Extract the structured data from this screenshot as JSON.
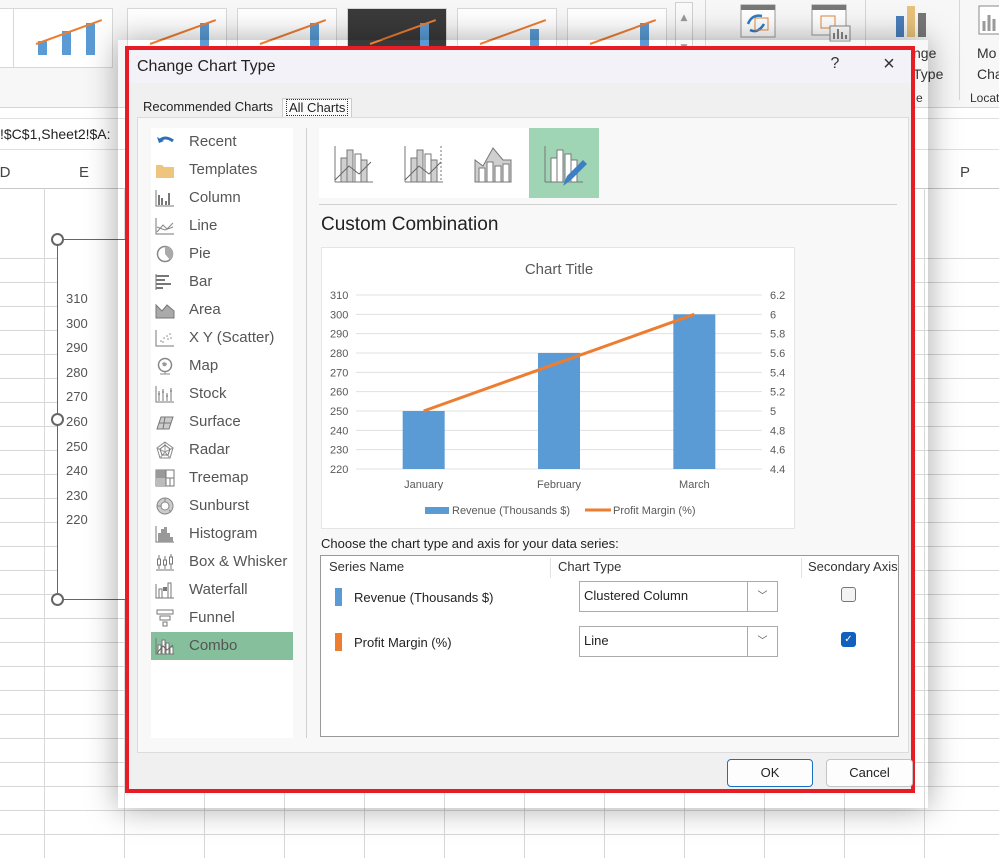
{
  "excel": {
    "formula_text": "!$C$1,Sheet2!$A:",
    "column_headers": [
      "D",
      "E",
      "P"
    ],
    "ribbon_labels": {
      "change_chart_type_line1": "nge",
      "change_chart_type_line2": "Type",
      "group_fragment": "e",
      "move_chart_line1": "Mo",
      "move_chart_line2": "Cha",
      "location_group": "Locat"
    },
    "background_axis_labels": [
      "310",
      "300",
      "290",
      "280",
      "270",
      "260",
      "250",
      "240",
      "230",
      "220"
    ]
  },
  "dialog": {
    "title": "Change Chart Type",
    "help_label": "?",
    "close_label": "×",
    "tabs": [
      {
        "label": "Recommended Charts",
        "active": false
      },
      {
        "label": "All Charts",
        "active": true
      }
    ],
    "chart_types": [
      {
        "label": "Recent",
        "icon": "recent-icon"
      },
      {
        "label": "Templates",
        "icon": "folder-icon"
      },
      {
        "label": "Column",
        "icon": "column-chart-icon"
      },
      {
        "label": "Line",
        "icon": "line-chart-icon"
      },
      {
        "label": "Pie",
        "icon": "pie-chart-icon"
      },
      {
        "label": "Bar",
        "icon": "bar-chart-icon"
      },
      {
        "label": "Area",
        "icon": "area-chart-icon"
      },
      {
        "label": "X Y (Scatter)",
        "icon": "scatter-chart-icon"
      },
      {
        "label": "Map",
        "icon": "map-chart-icon"
      },
      {
        "label": "Stock",
        "icon": "stock-chart-icon"
      },
      {
        "label": "Surface",
        "icon": "surface-chart-icon"
      },
      {
        "label": "Radar",
        "icon": "radar-chart-icon"
      },
      {
        "label": "Treemap",
        "icon": "treemap-chart-icon"
      },
      {
        "label": "Sunburst",
        "icon": "sunburst-chart-icon"
      },
      {
        "label": "Histogram",
        "icon": "histogram-chart-icon"
      },
      {
        "label": "Box & Whisker",
        "icon": "box-whisker-chart-icon"
      },
      {
        "label": "Waterfall",
        "icon": "waterfall-chart-icon"
      },
      {
        "label": "Funnel",
        "icon": "funnel-chart-icon"
      },
      {
        "label": "Combo",
        "icon": "combo-chart-icon",
        "selected": true
      }
    ],
    "subtypes": [
      {
        "name": "clustered-column-line",
        "selected": false
      },
      {
        "name": "clustered-column-line-secondary-axis",
        "selected": false
      },
      {
        "name": "stacked-area-clustered-column",
        "selected": false
      },
      {
        "name": "custom-combination",
        "selected": true
      }
    ],
    "subtype_heading": "Custom Combination",
    "series_caption": "Choose the chart type and axis for your data series:",
    "series_table": {
      "headers": [
        "Series Name",
        "Chart Type",
        "Secondary Axis"
      ],
      "rows": [
        {
          "name": "Revenue (Thousands $)",
          "color": "#5b9bd5",
          "chart_type": "Clustered Column",
          "secondary_axis": false
        },
        {
          "name": "Profit Margin (%)",
          "color": "#ed7d31",
          "chart_type": "Line",
          "secondary_axis": true
        }
      ]
    },
    "buttons": {
      "ok": "OK",
      "cancel": "Cancel"
    }
  },
  "chart_data": {
    "type": "bar",
    "title": "Chart Title",
    "categories": [
      "January",
      "February",
      "March"
    ],
    "series": [
      {
        "name": "Revenue (Thousands $)",
        "type": "bar",
        "axis": "primary",
        "color": "#5b9bd5",
        "values": [
          250,
          280,
          300
        ]
      },
      {
        "name": "Profit Margin (%)",
        "type": "line",
        "axis": "secondary",
        "color": "#ed7d31",
        "values": [
          5.0,
          5.5,
          6.0
        ]
      }
    ],
    "primary_axis": {
      "min": 220,
      "max": 310,
      "step": 10,
      "ticks": [
        "310",
        "300",
        "290",
        "280",
        "270",
        "260",
        "250",
        "240",
        "230",
        "220"
      ]
    },
    "secondary_axis": {
      "min": 4.4,
      "max": 6.2,
      "step": 0.2,
      "ticks": [
        "6.2",
        "6",
        "5.8",
        "5.6",
        "5.4",
        "5.2",
        "5",
        "4.8",
        "4.6",
        "4.4"
      ]
    },
    "grid": true,
    "legend": "bottom",
    "xlabel": "",
    "ylabel": ""
  }
}
